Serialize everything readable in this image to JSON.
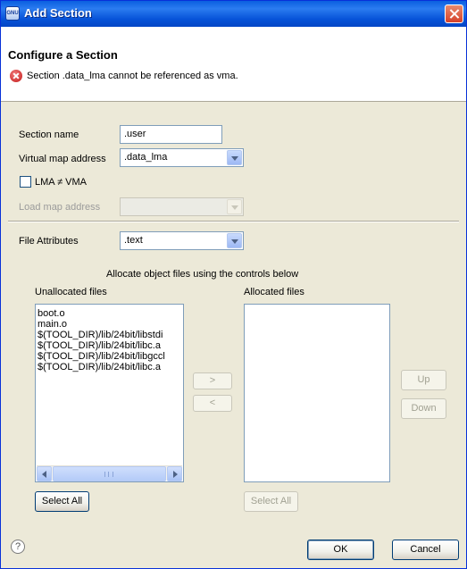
{
  "window": {
    "title": "Add Section",
    "app_icon_text": "GNU"
  },
  "header": {
    "title": "Configure a Section",
    "error_message": "Section .data_lma cannot be referenced as vma."
  },
  "form": {
    "section_name_label": "Section name",
    "section_name_value": ".user",
    "vma_label": "Virtual map address",
    "vma_value": ".data_lma",
    "lma_vma_label": "LMA ≠ VMA",
    "lma_vma_checked": false,
    "lma_label": "Load map address",
    "lma_value": "",
    "file_attributes_label": "File Attributes",
    "file_attributes_value": ".text"
  },
  "allocation": {
    "instructions": "Allocate object files using the controls below",
    "unallocated_label": "Unallocated files",
    "allocated_label": "Allocated files",
    "unallocated_files": [
      "boot.o",
      "main.o",
      "$(TOOL_DIR)/lib/24bit/libstdi",
      "$(TOOL_DIR)/lib/24bit/libc.a",
      "$(TOOL_DIR)/lib/24bit/libgccl",
      "$(TOOL_DIR)/lib/24bit/libc.a"
    ],
    "allocated_files": [],
    "move_right": ">",
    "move_left": "<",
    "up": "Up",
    "down": "Down",
    "select_all_left": "Select All",
    "select_all_right": "Select All"
  },
  "footer": {
    "help": "?",
    "ok": "OK",
    "cancel": "Cancel"
  }
}
